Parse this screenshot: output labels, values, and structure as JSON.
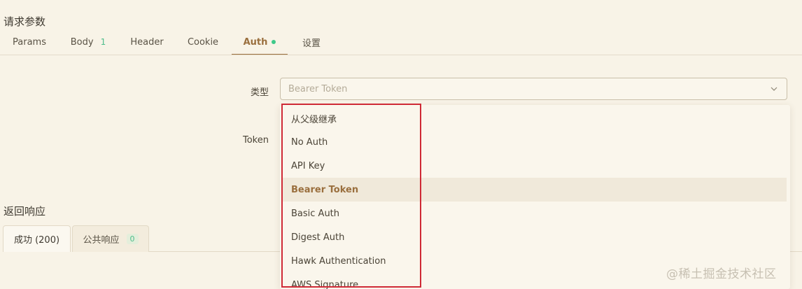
{
  "request_section": {
    "title": "请求参数",
    "tabs": [
      {
        "label": "Params"
      },
      {
        "label": "Body",
        "count": "1"
      },
      {
        "label": "Header"
      },
      {
        "label": "Cookie"
      },
      {
        "label": "Auth",
        "active": true
      },
      {
        "label": "设置"
      }
    ]
  },
  "auth_form": {
    "type_label": "类型",
    "type_value": "Bearer Token",
    "token_label": "Token"
  },
  "dropdown": {
    "options": [
      "从父级继承",
      "No Auth",
      "API Key",
      "Bearer Token",
      "Basic Auth",
      "Digest Auth",
      "Hawk Authentication",
      "AWS Signature"
    ],
    "selected": "Bearer Token"
  },
  "response_section": {
    "title": "返回响应",
    "tabs": [
      {
        "label": "成功 (200)"
      },
      {
        "label": "公共响应",
        "count": "0"
      }
    ]
  },
  "watermark": "@稀土掘金技术社区",
  "colors": {
    "background": "#f8f3e7",
    "accent": "#9a6f3e",
    "status_dot": "#3ec98a",
    "highlight_box": "#cf2a36"
  }
}
